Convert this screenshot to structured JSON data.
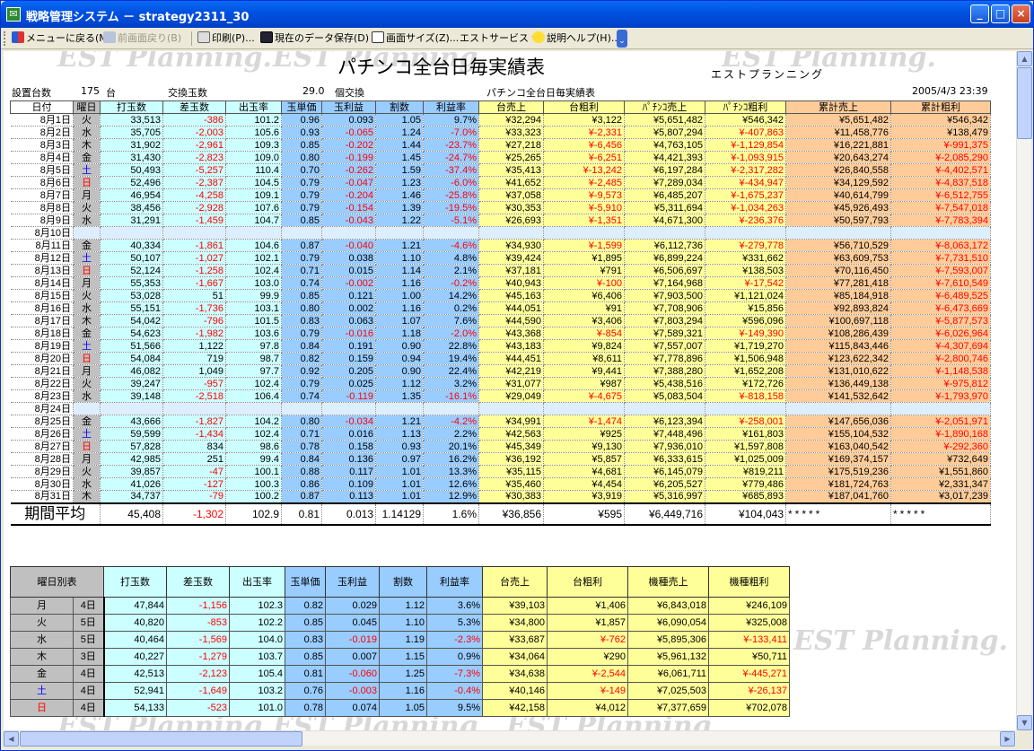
{
  "window": {
    "title": "戦略管理システム － strategy2311_30",
    "min": "_",
    "max": "□",
    "close": "×"
  },
  "toolbar": [
    {
      "label": "メニューに戻る(M)",
      "icon": "menu-return-icon",
      "disabled": false
    },
    {
      "label": "前画面戻り(B)",
      "icon": "undo-icon",
      "disabled": true
    },
    {
      "label": "印刷(P)...",
      "icon": "printer-icon",
      "disabled": false
    },
    {
      "label": "現在のデータ保存(D)",
      "icon": "save-icon",
      "disabled": false
    },
    {
      "label": "画面サイズ(Z)...",
      "icon": "window-size-icon",
      "disabled": false
    },
    {
      "label": "エストサービス ▾",
      "icon": "",
      "disabled": false
    },
    {
      "label": "説明ヘルプ(H)...",
      "icon": "help-icon",
      "disabled": false
    }
  ],
  "report": {
    "title": "パチンコ全台日毎実績表",
    "company": "エストプランニング",
    "installed_label": "設置台数",
    "installed_value": "175",
    "installed_unit": "台",
    "exchange_label": "交換玉数",
    "exchange_value": "29.0",
    "exchange_unit": "個交換",
    "subtitle": "パチンコ全台日毎実績表",
    "datetime": "2005/4/3 23:39",
    "watermark": "EST Planning."
  },
  "daily": {
    "headers": [
      "日付",
      "曜日",
      "打玉数",
      "差玉数",
      "出玉率",
      "玉単価",
      "玉利益",
      "割数",
      "利益率",
      "台売上",
      "台粗利",
      "ﾊﾟﾁﾝｺ売上",
      "ﾊﾟﾁﾝｺ粗利",
      "累計売上",
      "累計粗利"
    ],
    "rows": [
      [
        "8月1日",
        "火",
        "33,513",
        "-386",
        "101.2",
        "0.96",
        "0.093",
        "1.05",
        "9.7%",
        "¥32,294",
        "¥3,122",
        "¥5,651,482",
        "¥546,342",
        "¥5,651,482",
        "¥546,342"
      ],
      [
        "8月2日",
        "水",
        "35,705",
        "-2,003",
        "105.6",
        "0.93",
        "-0.065",
        "1.24",
        "-7.0%",
        "¥33,323",
        "¥-2,331",
        "¥5,807,294",
        "¥-407,863",
        "¥11,458,776",
        "¥138,479"
      ],
      [
        "8月3日",
        "木",
        "31,902",
        "-2,961",
        "109.3",
        "0.85",
        "-0.202",
        "1.44",
        "-23.7%",
        "¥27,218",
        "¥-6,456",
        "¥4,763,105",
        "¥-1,129,854",
        "¥16,221,881",
        "¥-991,375"
      ],
      [
        "8月4日",
        "金",
        "31,430",
        "-2,823",
        "109.0",
        "0.80",
        "-0.199",
        "1.45",
        "-24.7%",
        "¥25,265",
        "¥-6,251",
        "¥4,421,393",
        "¥-1,093,915",
        "¥20,643,274",
        "¥-2,085,290"
      ],
      [
        "8月5日",
        "土",
        "50,493",
        "-5,257",
        "110.4",
        "0.70",
        "-0.262",
        "1.59",
        "-37.4%",
        "¥35,413",
        "¥-13,242",
        "¥6,197,284",
        "¥-2,317,282",
        "¥26,840,558",
        "¥-4,402,571"
      ],
      [
        "8月6日",
        "日",
        "52,496",
        "-2,387",
        "104.5",
        "0.79",
        "-0.047",
        "1.23",
        "-6.0%",
        "¥41,652",
        "¥-2,485",
        "¥7,289,034",
        "¥-434,947",
        "¥34,129,592",
        "¥-4,837,518"
      ],
      [
        "8月7日",
        "月",
        "46,954",
        "-4,258",
        "109.1",
        "0.79",
        "-0.204",
        "1.46",
        "-25.8%",
        "¥37,058",
        "¥-9,573",
        "¥6,485,207",
        "¥-1,675,237",
        "¥40,614,799",
        "¥-6,512,755"
      ],
      [
        "8月8日",
        "火",
        "38,456",
        "-2,928",
        "107.6",
        "0.79",
        "-0.154",
        "1.39",
        "-19.5%",
        "¥30,353",
        "¥-5,910",
        "¥5,311,694",
        "¥-1,034,263",
        "¥45,926,493",
        "¥-7,547,018"
      ],
      [
        "8月9日",
        "水",
        "31,291",
        "-1,459",
        "104.7",
        "0.85",
        "-0.043",
        "1.22",
        "-5.1%",
        "¥26,693",
        "¥-1,351",
        "¥4,671,300",
        "¥-236,376",
        "¥50,597,793",
        "¥-7,783,394"
      ],
      [
        "8月10日",
        "",
        "",
        "",
        "",
        "",
        "",
        "",
        "",
        "",
        "",
        "",
        "",
        "",
        ""
      ],
      [
        "8月11日",
        "金",
        "40,334",
        "-1,861",
        "104.6",
        "0.87",
        "-0.040",
        "1.21",
        "-4.6%",
        "¥34,930",
        "¥-1,599",
        "¥6,112,736",
        "¥-279,778",
        "¥56,710,529",
        "¥-8,063,172"
      ],
      [
        "8月12日",
        "土",
        "50,107",
        "-1,027",
        "102.1",
        "0.79",
        "0.038",
        "1.10",
        "4.8%",
        "¥39,424",
        "¥1,895",
        "¥6,899,224",
        "¥331,662",
        "¥63,609,753",
        "¥-7,731,510"
      ],
      [
        "8月13日",
        "日",
        "52,124",
        "-1,258",
        "102.4",
        "0.71",
        "0.015",
        "1.14",
        "2.1%",
        "¥37,181",
        "¥791",
        "¥6,506,697",
        "¥138,503",
        "¥70,116,450",
        "¥-7,593,007"
      ],
      [
        "8月14日",
        "月",
        "55,353",
        "-1,667",
        "103.0",
        "0.74",
        "-0.002",
        "1.16",
        "-0.2%",
        "¥40,943",
        "¥-100",
        "¥7,164,968",
        "¥-17,542",
        "¥77,281,418",
        "¥-7,610,549"
      ],
      [
        "8月15日",
        "火",
        "53,028",
        "51",
        "99.9",
        "0.85",
        "0.121",
        "1.00",
        "14.2%",
        "¥45,163",
        "¥6,406",
        "¥7,903,500",
        "¥1,121,024",
        "¥85,184,918",
        "¥-6,489,525"
      ],
      [
        "8月16日",
        "水",
        "55,151",
        "-1,736",
        "103.1",
        "0.80",
        "0.002",
        "1.16",
        "0.2%",
        "¥44,051",
        "¥91",
        "¥7,708,906",
        "¥15,856",
        "¥92,893,824",
        "¥-6,473,669"
      ],
      [
        "8月17日",
        "木",
        "54,042",
        "-796",
        "101.5",
        "0.83",
        "0.063",
        "1.07",
        "7.6%",
        "¥44,590",
        "¥3,406",
        "¥7,803,294",
        "¥596,096",
        "¥100,697,118",
        "¥-5,877,573"
      ],
      [
        "8月18日",
        "金",
        "54,623",
        "-1,982",
        "103.6",
        "0.79",
        "-0.016",
        "1.18",
        "-2.0%",
        "¥43,368",
        "¥-854",
        "¥7,589,321",
        "¥-149,390",
        "¥108,286,439",
        "¥-6,026,964"
      ],
      [
        "8月19日",
        "土",
        "51,566",
        "1,122",
        "97.8",
        "0.84",
        "0.191",
        "0.90",
        "22.8%",
        "¥43,183",
        "¥9,824",
        "¥7,557,007",
        "¥1,719,270",
        "¥115,843,446",
        "¥-4,307,694"
      ],
      [
        "8月20日",
        "日",
        "54,084",
        "719",
        "98.7",
        "0.82",
        "0.159",
        "0.94",
        "19.4%",
        "¥44,451",
        "¥8,611",
        "¥7,778,896",
        "¥1,506,948",
        "¥123,622,342",
        "¥-2,800,746"
      ],
      [
        "8月21日",
        "月",
        "46,082",
        "1,049",
        "97.7",
        "0.92",
        "0.205",
        "0.90",
        "22.4%",
        "¥42,219",
        "¥9,441",
        "¥7,388,280",
        "¥1,652,208",
        "¥131,010,622",
        "¥-1,148,538"
      ],
      [
        "8月22日",
        "火",
        "39,247",
        "-957",
        "102.4",
        "0.79",
        "0.025",
        "1.12",
        "3.2%",
        "¥31,077",
        "¥987",
        "¥5,438,516",
        "¥172,726",
        "¥136,449,138",
        "¥-975,812"
      ],
      [
        "8月23日",
        "水",
        "39,148",
        "-2,518",
        "106.4",
        "0.74",
        "-0.119",
        "1.35",
        "-16.1%",
        "¥29,049",
        "¥-4,675",
        "¥5,083,504",
        "¥-818,158",
        "¥141,532,642",
        "¥-1,793,970"
      ],
      [
        "8月24日",
        "",
        "",
        "",
        "",
        "",
        "",
        "",
        "",
        "",
        "",
        "",
        "",
        "",
        ""
      ],
      [
        "8月25日",
        "金",
        "43,666",
        "-1,827",
        "104.2",
        "0.80",
        "-0.034",
        "1.21",
        "-4.2%",
        "¥34,991",
        "¥-1,474",
        "¥6,123,394",
        "¥-258,001",
        "¥147,656,036",
        "¥-2,051,971"
      ],
      [
        "8月26日",
        "土",
        "59,599",
        "-1,434",
        "102.4",
        "0.71",
        "0.016",
        "1.13",
        "2.2%",
        "¥42,563",
        "¥925",
        "¥7,448,496",
        "¥161,803",
        "¥155,104,532",
        "¥-1,890,168"
      ],
      [
        "8月27日",
        "日",
        "57,828",
        "834",
        "98.6",
        "0.78",
        "0.158",
        "0.93",
        "20.1%",
        "¥45,349",
        "¥9,130",
        "¥7,936,010",
        "¥1,597,808",
        "¥163,040,542",
        "¥-292,360"
      ],
      [
        "8月28日",
        "月",
        "42,985",
        "251",
        "99.4",
        "0.84",
        "0.136",
        "0.97",
        "16.2%",
        "¥36,192",
        "¥5,857",
        "¥6,333,615",
        "¥1,025,009",
        "¥169,374,157",
        "¥732,649"
      ],
      [
        "8月29日",
        "火",
        "39,857",
        "-47",
        "100.1",
        "0.88",
        "0.117",
        "1.01",
        "13.3%",
        "¥35,115",
        "¥4,681",
        "¥6,145,079",
        "¥819,211",
        "¥175,519,236",
        "¥1,551,860"
      ],
      [
        "8月30日",
        "水",
        "41,026",
        "-127",
        "100.3",
        "0.86",
        "0.109",
        "1.01",
        "12.6%",
        "¥35,460",
        "¥4,454",
        "¥6,205,527",
        "¥779,486",
        "¥181,724,763",
        "¥2,331,347"
      ],
      [
        "8月31日",
        "木",
        "34,737",
        "-79",
        "100.2",
        "0.87",
        "0.113",
        "1.01",
        "12.9%",
        "¥30,383",
        "¥3,919",
        "¥5,316,997",
        "¥685,893",
        "¥187,041,760",
        "¥3,017,239"
      ]
    ],
    "average": {
      "label": "期間平均",
      "values": [
        "45,408",
        "-1,302",
        "102.9",
        "0.81",
        "0.013",
        "1.14129",
        "1.6%",
        "¥36,856",
        "¥595",
        "¥6,449,716",
        "¥104,043",
        "*****",
        "*****"
      ]
    }
  },
  "weekday": {
    "headers": [
      "曜日別表",
      "打玉数",
      "差玉数",
      "出玉率",
      "玉単価",
      "玉利益",
      "割数",
      "利益率",
      "台売上",
      "台粗利",
      "機種売上",
      "機種粗利"
    ],
    "rows": [
      [
        "月",
        "4日",
        "47,844",
        "-1,156",
        "102.3",
        "0.82",
        "0.029",
        "1.12",
        "3.6%",
        "¥39,103",
        "¥1,406",
        "¥6,843,018",
        "¥246,109"
      ],
      [
        "火",
        "5日",
        "40,820",
        "-853",
        "102.2",
        "0.85",
        "0.045",
        "1.10",
        "5.3%",
        "¥34,800",
        "¥1,857",
        "¥6,090,054",
        "¥325,008"
      ],
      [
        "水",
        "5日",
        "40,464",
        "-1,569",
        "104.0",
        "0.83",
        "-0.019",
        "1.19",
        "-2.3%",
        "¥33,687",
        "¥-762",
        "¥5,895,306",
        "¥-133,411"
      ],
      [
        "木",
        "3日",
        "40,227",
        "-1,279",
        "103.7",
        "0.85",
        "0.007",
        "1.15",
        "0.9%",
        "¥34,064",
        "¥290",
        "¥5,961,132",
        "¥50,711"
      ],
      [
        "金",
        "4日",
        "42,513",
        "-2,123",
        "105.4",
        "0.81",
        "-0.060",
        "1.25",
        "-7.3%",
        "¥34,638",
        "¥-2,544",
        "¥6,061,711",
        "¥-445,271"
      ],
      [
        "土",
        "4日",
        "52,941",
        "-1,649",
        "103.2",
        "0.76",
        "-0.003",
        "1.16",
        "-0.4%",
        "¥40,146",
        "¥-149",
        "¥7,025,503",
        "¥-26,137"
      ],
      [
        "日",
        "4日",
        "54,133",
        "-523",
        "101.0",
        "0.78",
        "0.074",
        "1.05",
        "9.5%",
        "¥42,158",
        "¥4,012",
        "¥7,377,659",
        "¥702,078"
      ]
    ]
  },
  "colors": {
    "accent": "#0a246a",
    "negative": "#ff0000",
    "saturday": "#0000ff",
    "sunday": "#ff0000",
    "yellow": "#ffff99",
    "orange": "#ffcc99",
    "blue": "#99ccff",
    "cyan": "#ccffff"
  }
}
